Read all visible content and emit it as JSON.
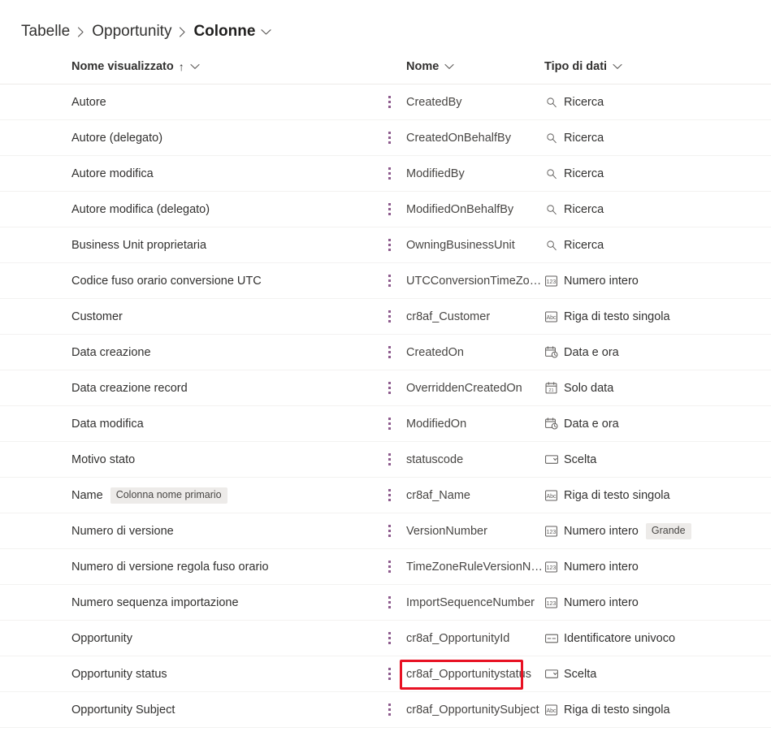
{
  "breadcrumb": {
    "items": [
      {
        "label": "Tabelle",
        "current": false
      },
      {
        "label": "Opportunity",
        "current": false
      },
      {
        "label": "Colonne",
        "current": true
      }
    ],
    "separator": "›",
    "caret": "⌄"
  },
  "table": {
    "columns": [
      {
        "key": "display_name",
        "label": "Nome visualizzato",
        "sorted": true,
        "sort_arrow": "↑",
        "caret": "⌄"
      },
      {
        "key": "name",
        "label": "Nome",
        "sorted": false,
        "caret": "⌄"
      },
      {
        "key": "data_type",
        "label": "Tipo di dati",
        "sorted": false,
        "caret": "⌄"
      }
    ],
    "row_menu_icon": "more-vertical-icon",
    "rows": [
      {
        "display_name": "Autore",
        "badge": "",
        "name": "CreatedBy",
        "data_type": "Ricerca",
        "icon": "search-icon"
      },
      {
        "display_name": "Autore (delegato)",
        "badge": "",
        "name": "CreatedOnBehalfBy",
        "data_type": "Ricerca",
        "icon": "search-icon"
      },
      {
        "display_name": "Autore modifica",
        "badge": "",
        "name": "ModifiedBy",
        "data_type": "Ricerca",
        "icon": "search-icon"
      },
      {
        "display_name": "Autore modifica (delegato)",
        "badge": "",
        "name": "ModifiedOnBehalfBy",
        "data_type": "Ricerca",
        "icon": "search-icon"
      },
      {
        "display_name": "Business Unit proprietaria",
        "badge": "",
        "name": "OwningBusinessUnit",
        "data_type": "Ricerca",
        "icon": "search-icon"
      },
      {
        "display_name": "Codice fuso orario conversione UTC",
        "badge": "",
        "name": "UTCConversionTimeZoneC…",
        "data_type": "Numero intero",
        "icon": "number-icon"
      },
      {
        "display_name": "Customer",
        "badge": "",
        "name": "cr8af_Customer",
        "data_type": "Riga di testo singola",
        "icon": "text-icon"
      },
      {
        "display_name": "Data creazione",
        "badge": "",
        "name": "CreatedOn",
        "data_type": "Data e ora",
        "icon": "datetime-icon"
      },
      {
        "display_name": "Data creazione record",
        "badge": "",
        "name": "OverriddenCreatedOn",
        "data_type": "Solo data",
        "icon": "calendar-icon"
      },
      {
        "display_name": "Data modifica",
        "badge": "",
        "name": "ModifiedOn",
        "data_type": "Data e ora",
        "icon": "datetime-icon"
      },
      {
        "display_name": "Motivo stato",
        "badge": "",
        "name": "statuscode",
        "data_type": "Scelta",
        "icon": "choice-icon"
      },
      {
        "display_name": "Name",
        "badge": "Colonna nome primario",
        "name": "cr8af_Name",
        "data_type": "Riga di testo singola",
        "icon": "text-icon"
      },
      {
        "display_name": "Numero di versione",
        "badge": "",
        "name": "VersionNumber",
        "data_type": "Numero intero",
        "icon": "number-icon",
        "type_badge": "Grande"
      },
      {
        "display_name": "Numero di versione regola fuso orario",
        "badge": "",
        "name": "TimeZoneRuleVersionNum…",
        "data_type": "Numero intero",
        "icon": "number-icon"
      },
      {
        "display_name": "Numero sequenza importazione",
        "badge": "",
        "name": "ImportSequenceNumber",
        "data_type": "Numero intero",
        "icon": "number-icon"
      },
      {
        "display_name": "Opportunity",
        "badge": "",
        "name": "cr8af_OpportunityId",
        "data_type": "Identificatore univoco",
        "icon": "guid-icon"
      },
      {
        "display_name": "Opportunity status",
        "badge": "",
        "name": "cr8af_Opportunitystatus",
        "data_type": "Scelta",
        "icon": "choice-icon",
        "highlighted": true
      },
      {
        "display_name": "Opportunity Subject",
        "badge": "",
        "name": "cr8af_OpportunitySubject",
        "data_type": "Riga di testo singola",
        "icon": "text-icon"
      }
    ]
  },
  "annotation": {
    "highlight_color": "#e81123",
    "highlight_target": "cr8af_Opportunitystatus"
  }
}
